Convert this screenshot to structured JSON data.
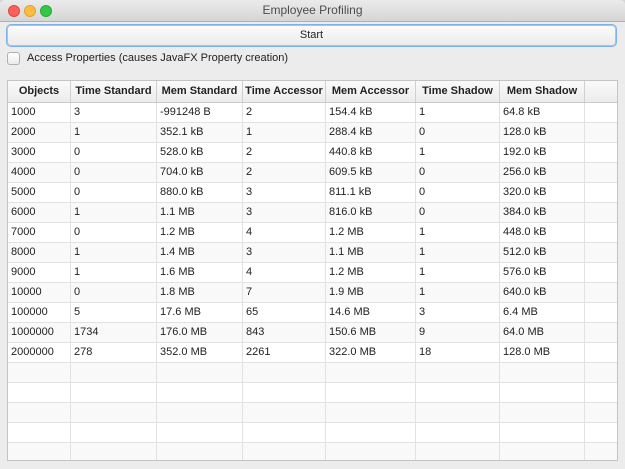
{
  "window": {
    "title": "Employee Profiling"
  },
  "controls": {
    "start_label": "Start",
    "access_properties_label": "Access Properties (causes JavaFX Property creation)",
    "access_properties_checked": false
  },
  "table": {
    "columns": [
      "Objects",
      "Time Standard",
      "Mem Standard",
      "Time Accessor",
      "Mem Accessor",
      "Time Shadow",
      "Mem Shadow"
    ],
    "rows": [
      [
        "1000",
        "3",
        "-991248 B",
        "2",
        "154.4 kB",
        "1",
        "64.8 kB"
      ],
      [
        "2000",
        "1",
        "352.1 kB",
        "1",
        "288.4 kB",
        "0",
        "128.0 kB"
      ],
      [
        "3000",
        "0",
        "528.0 kB",
        "2",
        "440.8 kB",
        "1",
        "192.0 kB"
      ],
      [
        "4000",
        "0",
        "704.0 kB",
        "2",
        "609.5 kB",
        "0",
        "256.0 kB"
      ],
      [
        "5000",
        "0",
        "880.0 kB",
        "3",
        "811.1 kB",
        "0",
        "320.0 kB"
      ],
      [
        "6000",
        "1",
        "1.1 MB",
        "3",
        "816.0 kB",
        "0",
        "384.0 kB"
      ],
      [
        "7000",
        "0",
        "1.2 MB",
        "4",
        "1.2 MB",
        "1",
        "448.0 kB"
      ],
      [
        "8000",
        "1",
        "1.4 MB",
        "3",
        "1.1 MB",
        "1",
        "512.0 kB"
      ],
      [
        "9000",
        "1",
        "1.6 MB",
        "4",
        "1.2 MB",
        "1",
        "576.0 kB"
      ],
      [
        "10000",
        "0",
        "1.8 MB",
        "7",
        "1.9 MB",
        "1",
        "640.0 kB"
      ],
      [
        "100000",
        "5",
        "17.6 MB",
        "65",
        "14.6 MB",
        "3",
        "6.4 MB"
      ],
      [
        "1000000",
        "1734",
        "176.0 MB",
        "843",
        "150.6 MB",
        "9",
        "64.0 MB"
      ],
      [
        "2000000",
        "278",
        "352.0 MB",
        "2261",
        "322.0 MB",
        "18",
        "128.0 MB"
      ]
    ],
    "empty_rows": 5
  }
}
